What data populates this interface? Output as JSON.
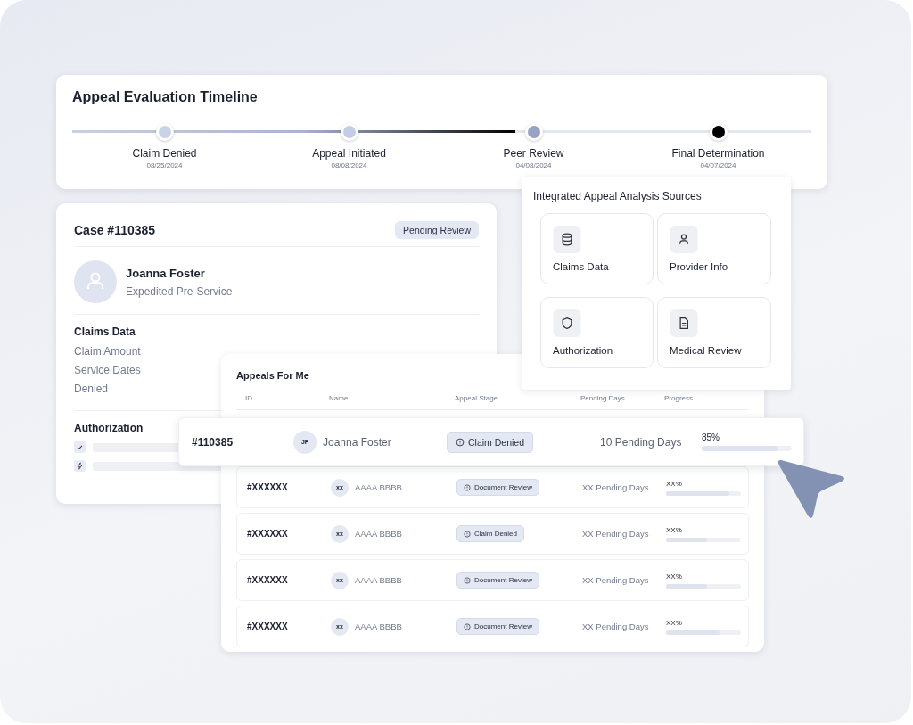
{
  "timeline": {
    "title": "Appeal Evaluation Timeline",
    "level": 0.6,
    "steps": [
      {
        "label": "Claim Denied",
        "date": "08/25/2024",
        "color": "#c9d3e8"
      },
      {
        "label": "Appeal Initiated",
        "date": "08/08/2024",
        "color": "#c3cde5"
      },
      {
        "label": "Peer Review",
        "date": "04/08/2024",
        "color": "#97a3c3"
      },
      {
        "label": "Final Determination",
        "date": "04/07/2024",
        "color": "#000000"
      }
    ]
  },
  "case": {
    "title": "Case #110385",
    "status": "Pending Review",
    "name": "Joanna Foster",
    "subtitle": "Expedited Pre-Service",
    "claims_heading": "Claims Data",
    "claims_rows": [
      "Claim Amount",
      "Service Dates",
      "Denied"
    ],
    "authorization_heading": "Authorization"
  },
  "sources": {
    "title": "Integrated Appeal Analysis Sources",
    "items": [
      "Claims Data",
      "Provider Info",
      "Authorization",
      "Medical Review"
    ]
  },
  "appeals": {
    "title": "Appeals For Me",
    "columns": [
      "ID",
      "Name",
      "Appeal Stage",
      "Pending Days",
      "Progress"
    ],
    "rows": [
      {
        "id": "#110385",
        "initials": "JF",
        "name": "Joanna Foster",
        "stage": "Claim Denied",
        "pending": "10 Pending Days",
        "progress": "85%",
        "level": 0.85,
        "raised": true
      },
      {
        "id": "#XXXXXX",
        "initials": "xx",
        "name": "AAAA BBBB",
        "stage": "Document Review",
        "pending": "XX Pending Days",
        "progress": "XX%",
        "level": 0.85,
        "raised": false
      },
      {
        "id": "#XXXXXX",
        "initials": "xx",
        "name": "AAAA BBBB",
        "stage": "Claim Denied",
        "pending": "XX Pending Days",
        "progress": "XX%",
        "level": 0.55,
        "raised": false
      },
      {
        "id": "#XXXXXX",
        "initials": "xx",
        "name": "AAAA BBBB",
        "stage": "Document Review",
        "pending": "XX Pending Days",
        "progress": "XX%",
        "level": 0.55,
        "raised": false
      },
      {
        "id": "#XXXXXX",
        "initials": "xx",
        "name": "AAAA BBBB",
        "stage": "Document Review",
        "pending": "XX Pending Days",
        "progress": "XX%",
        "level": 0.72,
        "raised": false
      }
    ]
  }
}
